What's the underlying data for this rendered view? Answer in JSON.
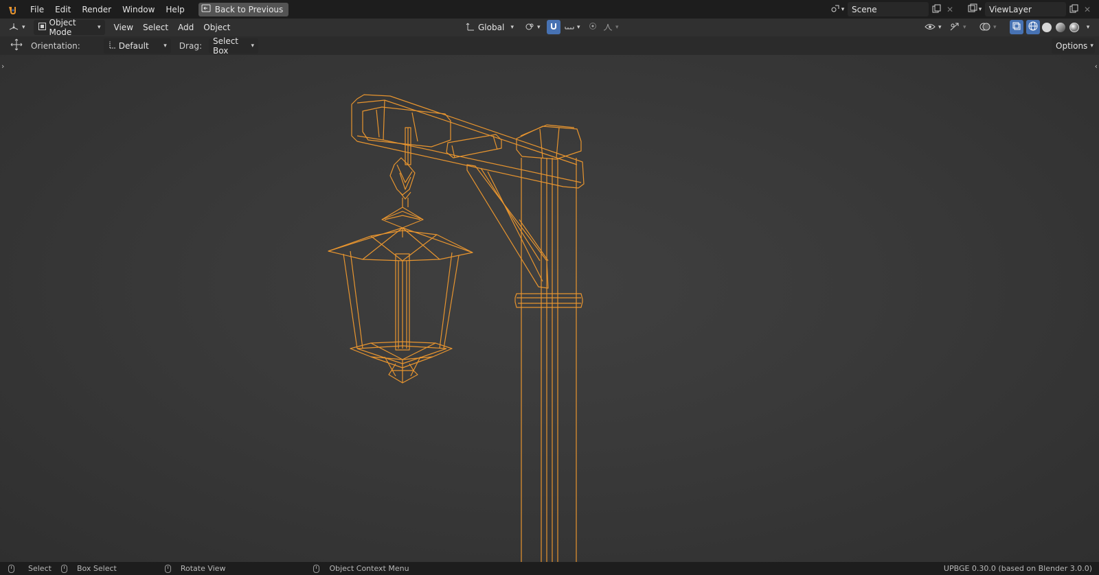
{
  "topbar": {
    "menus": [
      "File",
      "Edit",
      "Render",
      "Window",
      "Help"
    ],
    "back_button": "Back to Previous",
    "scene_name": "Scene",
    "view_layer_name": "ViewLayer"
  },
  "header": {
    "mode": "Object Mode",
    "menus": [
      "View",
      "Select",
      "Add",
      "Object"
    ],
    "transform_orientation": "Global"
  },
  "tool_settings": {
    "orientation_label": "Orientation:",
    "orientation_value": "Default",
    "drag_label": "Drag:",
    "drag_value": "Select Box",
    "options_label": "Options"
  },
  "status": {
    "select": "Select",
    "box_select": "Box Select",
    "rotate_view": "Rotate View",
    "context_menu": "Object Context Menu",
    "version": "UPBGE 0.30.0 (based on Blender 3.0.0)"
  },
  "colors": {
    "wire": "#e8952f",
    "accent": "#4772b3"
  }
}
